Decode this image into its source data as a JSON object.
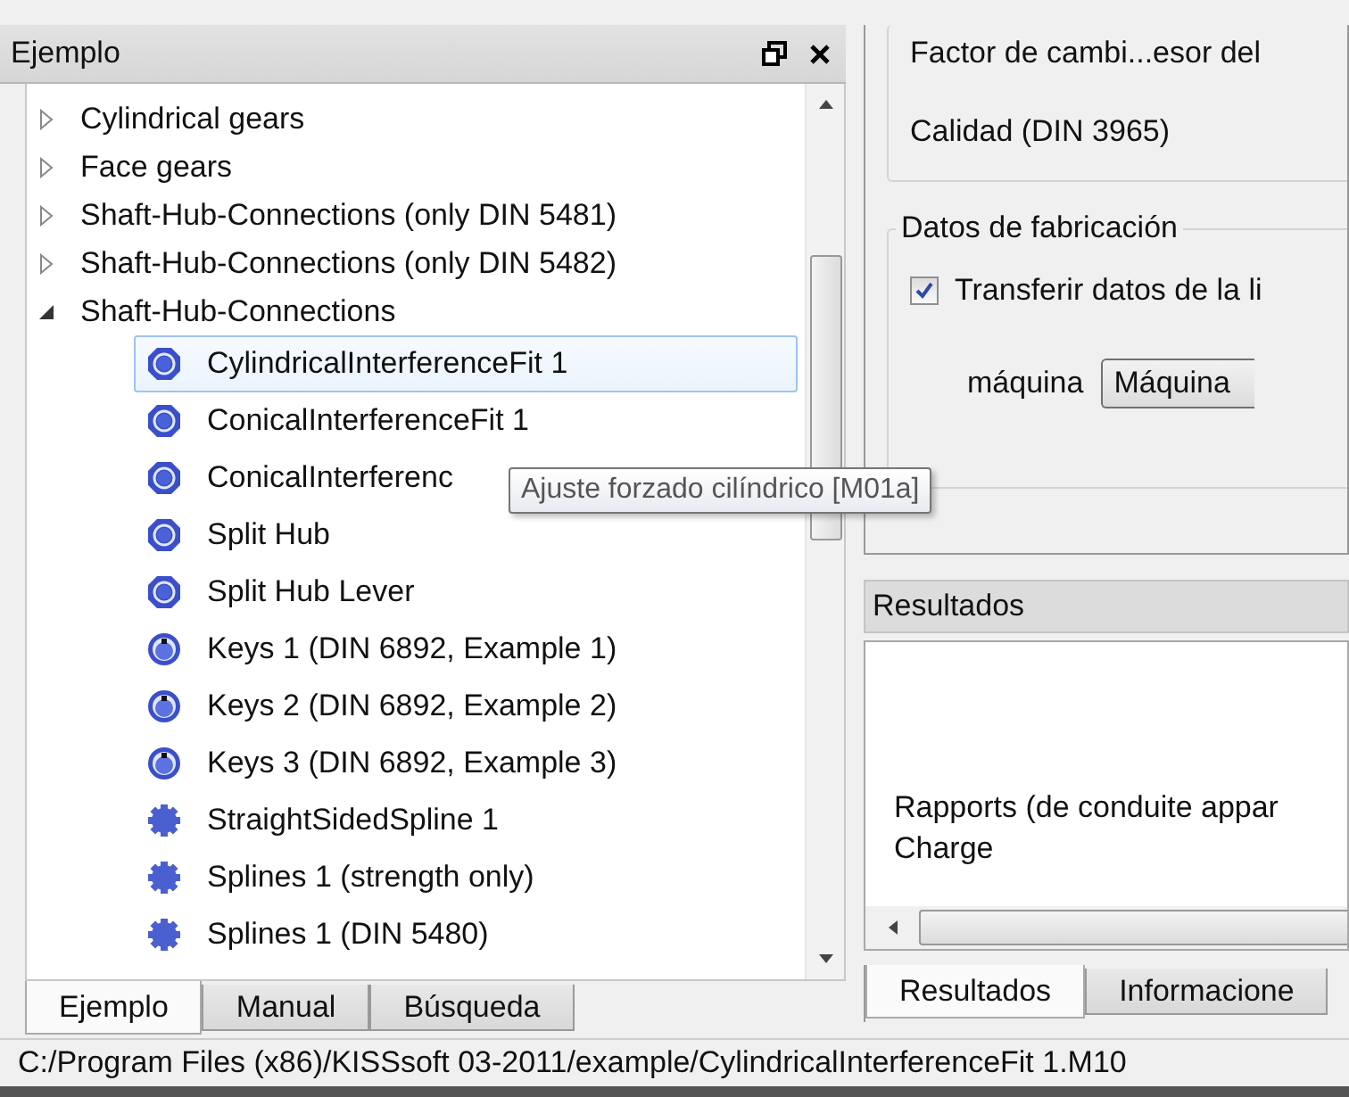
{
  "left_panel": {
    "title": "Ejemplo",
    "tree": [
      {
        "label": "Cylindrical gears",
        "expanded": false
      },
      {
        "label": "Face gears",
        "expanded": false
      },
      {
        "label": "Shaft-Hub-Connections (only DIN 5481)",
        "expanded": false
      },
      {
        "label": "Shaft-Hub-Connections (only DIN 5482)",
        "expanded": false
      },
      {
        "label": "Shaft-Hub-Connections",
        "expanded": true,
        "children": [
          {
            "label": "CylindricalInterferenceFit 1",
            "kind": "fit",
            "selected": true
          },
          {
            "label": "ConicalInterferenceFit 1",
            "kind": "fit",
            "selected": false
          },
          {
            "label": "ConicalInterferenc",
            "kind": "fit",
            "selected": false
          },
          {
            "label": "Split Hub",
            "kind": "fit",
            "selected": false
          },
          {
            "label": "Split Hub Lever",
            "kind": "fit",
            "selected": false
          },
          {
            "label": "Keys 1 (DIN 6892, Example 1)",
            "kind": "key",
            "selected": false
          },
          {
            "label": "Keys 2 (DIN 6892, Example 2)",
            "kind": "key",
            "selected": false
          },
          {
            "label": "Keys 3 (DIN 6892, Example 3)",
            "kind": "key",
            "selected": false
          },
          {
            "label": "StraightSidedSpline 1",
            "kind": "spline",
            "selected": false
          },
          {
            "label": "Splines 1 (strength only)",
            "kind": "spline",
            "selected": false
          },
          {
            "label": "Splines 1 (DIN 5480)",
            "kind": "spline",
            "selected": false
          }
        ]
      }
    ],
    "tooltip": "Ajuste forzado cilíndrico [M01a]",
    "tabs": [
      {
        "label": "Ejemplo",
        "selected": true
      },
      {
        "label": "Manual",
        "selected": false
      },
      {
        "label": "Búsqueda",
        "selected": false
      }
    ]
  },
  "right_panel": {
    "fields": [
      "Factor de cambi...esor del",
      "Calidad (DIN 3965)"
    ],
    "manufacturing": {
      "title": "Datos de fabricación",
      "checkbox": {
        "label": "Transferir datos de la li",
        "checked": true
      },
      "machine_label": "máquina",
      "machine_value": "Máquina"
    },
    "results": {
      "title": "Resultados",
      "lines": [
        "Rapports (de conduite appar",
        "Charge"
      ]
    },
    "tabs": [
      {
        "label": "Resultados",
        "selected": true
      },
      {
        "label": "Informacione",
        "selected": false
      }
    ]
  },
  "status_bar": "C:/Program Files (x86)/KISSsoft 03-2011/example/CylindricalInterferenceFit 1.M10"
}
